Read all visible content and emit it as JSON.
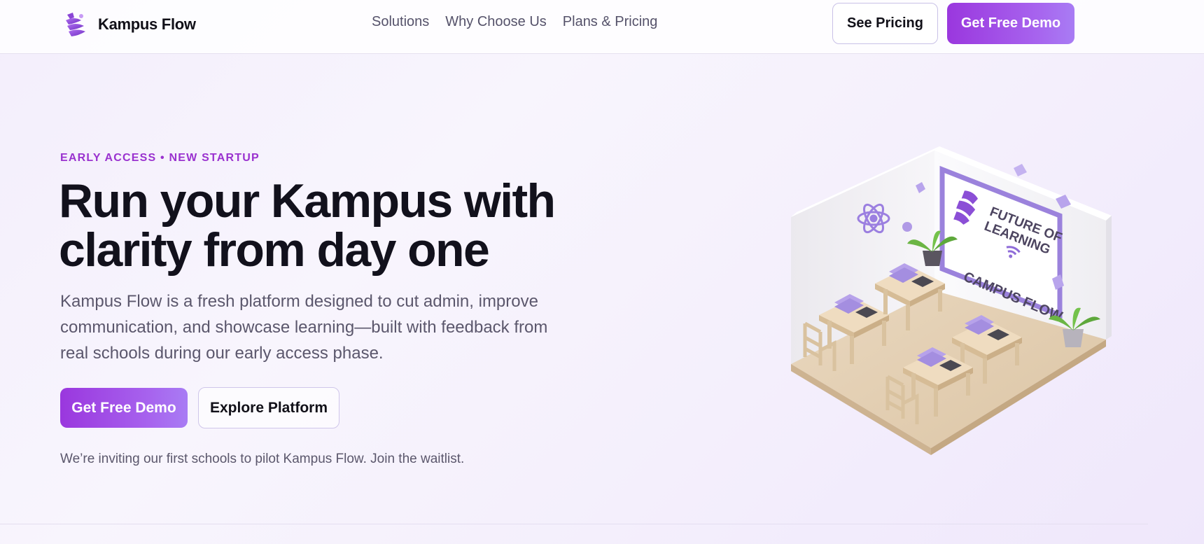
{
  "header": {
    "brand": "Kampus Flow",
    "logo_icon": "kampus-flow-logo-icon",
    "nav": [
      "Solutions",
      "Why Choose Us",
      "Plans & Pricing"
    ],
    "see_pricing": "See Pricing",
    "get_demo": "Get Free Demo"
  },
  "hero": {
    "eyebrow": "EARLY ACCESS • NEW STARTUP",
    "headline_line1": "Run your Kampus with",
    "headline_line2": "clarity from day one",
    "subtext": "Kampus Flow is a fresh platform designed to cut admin, improve communication, and showcase learning—built with feedback from real schools during our early access phase.",
    "primary_cta": "Get Free Demo",
    "secondary_cta": "Explore Platform",
    "note": "We’re inviting our first schools to pilot Kampus Flow. Join the waitlist."
  },
  "illustration": {
    "board_line1": "FUTURE OF",
    "board_line2": "LEARNING",
    "wall_text": "CAMPUS FLOW"
  },
  "colors": {
    "accent": "#9a37de",
    "accent_light": "#a87cf4",
    "eyebrow": "#9a32cf",
    "text_dark": "#12111c",
    "text_muted": "#5b576c"
  }
}
